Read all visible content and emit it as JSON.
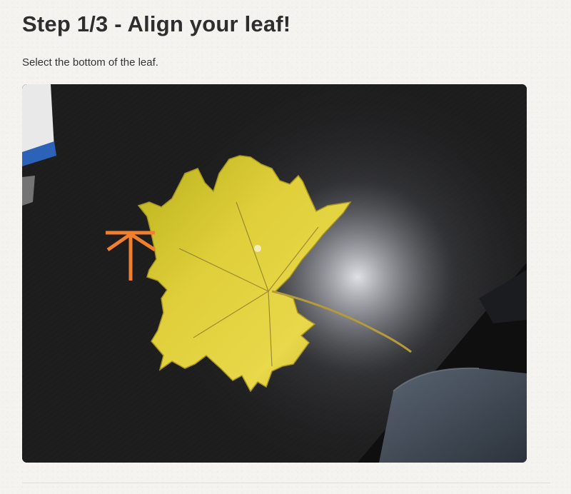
{
  "header": {
    "title": "Step 1/3 - Align your leaf!"
  },
  "instruction": {
    "text": "Select the bottom of the leaf."
  },
  "colors": {
    "accent": "#f07f2e",
    "leaf": "#d9c634",
    "table": "#161616",
    "background": "#f4f3f0"
  },
  "icons": {
    "marker": "bottom-marker-icon"
  }
}
